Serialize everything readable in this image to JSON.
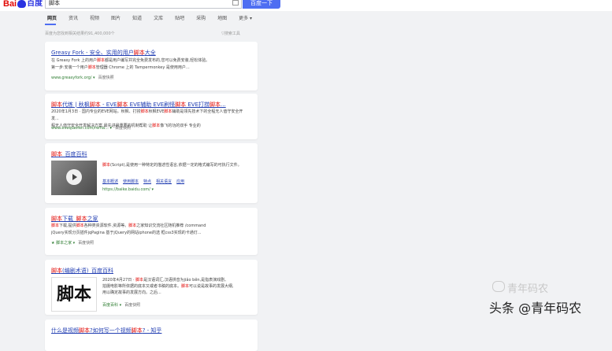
{
  "header": {
    "logo_bai": "Bai",
    "logo_du": "百度",
    "query": "脚本",
    "search_button": "百度一下"
  },
  "tabs": [
    {
      "label": "网页",
      "active": true
    },
    {
      "label": "资讯"
    },
    {
      "label": "视频"
    },
    {
      "label": "图片"
    },
    {
      "label": "知道"
    },
    {
      "label": "文库"
    },
    {
      "label": "贴吧"
    },
    {
      "label": "采购"
    },
    {
      "label": "地图"
    },
    {
      "label": "更多 ▾"
    }
  ],
  "stats": "百度为您找到相关结果约91,400,000个",
  "tools": "▽搜索工具",
  "results": [
    {
      "title": [
        "Greasy Fork - 安全、实用的用户",
        "脚本",
        "大全"
      ],
      "desc_lines": [
        [
          "在 Greasy Fork 上的用户",
          "脚本",
          "都是用户编写并完全免费发布的,您可以免费安装,轻松体验。"
        ],
        [
          "第一步:安装一个用户",
          "脚本",
          "管理器 Chrome 上的 Tampermonkey 是使用用户..."
        ]
      ],
      "url": "www.greasyfork.org/ ▾",
      "snapshot": "百度快照"
    },
    {
      "title": [
        "脚本",
        "代练 | 秋枫",
        "脚本",
        " - EVE",
        "脚本",
        " EVE辅助 EVE刷怪",
        "脚本",
        " EVE打捞",
        "脚本",
        "..."
      ],
      "desc_lines": [
        [
          "2020年1月3日 · 国内专业的EVE网站。秋枫、打捞",
          "脚本",
          "秋枫EVE",
          "脚本",
          "辅助是领先技术下的全程无人值守安全开发..."
        ],
        [
          "程无人值守安全开发解决方案,最先进最重要的机制帮助 让",
          "脚本",
          "像飞的功的双手 专业的"
        ]
      ],
      "url": "www.eveqiaofen.com/rema... ▾",
      "snapshot": "百度快照"
    },
    {
      "title": [
        "脚本",
        "_百度百科"
      ],
      "desc_lines": [
        [
          "脚本",
          "(Script),是使用一种特定的描述性语言,依据一定的格式编写的可执行文件。"
        ]
      ],
      "links": [
        "基本概述",
        "使用脚本",
        "特点",
        "相关语言",
        "应用"
      ],
      "url": "https://baike.baidu.com/ ▾"
    },
    {
      "title": [
        "脚本",
        "下载_",
        "脚本",
        "之家"
      ],
      "desc_lines": [
        [
          "脚本",
          "下载,提供",
          "脚本",
          "各种类资源软件,资源等。",
          "脚本",
          "之家知识交流社区随机推荐 /command"
        ],
        [
          "jQuery实现分页插件jqPagina 基于jQuery的网站iphone的选 框css3实现的卡通灯..."
        ]
      ],
      "url": "★ 脚本之家 ▾",
      "snapshot": "百度快照"
    },
    {
      "title": [
        "脚本",
        "(编剧术语)_百度百科"
      ],
      "image_text": "脚本",
      "desc_lines": [
        [
          "2020年4月27日 · ",
          "脚本",
          "是汉语词汇,汉语拼音为jiǎo běn,是指表演戏剧、"
        ],
        [
          "拍摄电影等所依据的底本又或者书稿的底本。",
          "脚本",
          "可以说是故事的发展大纲,"
        ],
        [
          "用以确定故事的发展方向。之后..."
        ]
      ],
      "url": "百度百科 ▾",
      "snapshot": "百度快照"
    },
    {
      "title": [
        "什么是视频",
        "脚本",
        "?如何写一个视频",
        "脚本",
        "? - 知乎"
      ]
    }
  ],
  "watermark": {
    "main": "头条 @青年码农",
    "faint": "青年码农"
  }
}
